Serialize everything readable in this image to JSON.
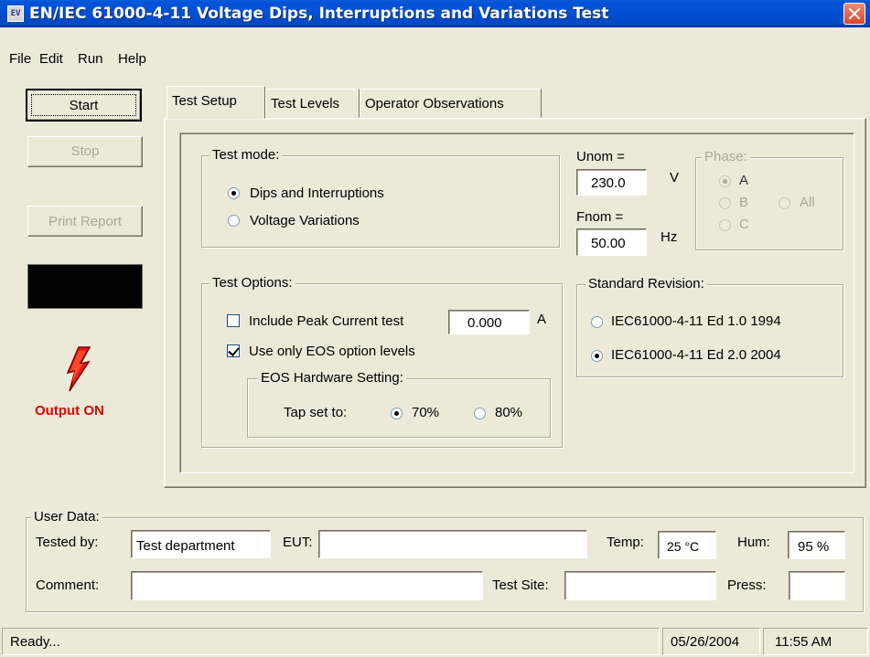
{
  "window": {
    "title": "EN/IEC 61000-4-11 Voltage Dips, Interruptions and Variations Test",
    "icon_text": "EV"
  },
  "menu": [
    {
      "label": "File"
    },
    {
      "label": "Edit"
    },
    {
      "label": "Run"
    },
    {
      "label": "Help"
    }
  ],
  "left_panel": {
    "start_label": "Start",
    "stop_label": "Stop",
    "print_label": "Print Report",
    "output_status": "Output ON",
    "output_color": "#e00000"
  },
  "tabs": [
    {
      "label": "Test Setup"
    },
    {
      "label": "Test Levels"
    },
    {
      "label": "Operator Observations"
    }
  ],
  "test_mode": {
    "title": "Test mode:",
    "options": [
      "Dips and Interruptions",
      "Voltage Variations"
    ],
    "selected": "Dips and Interruptions"
  },
  "nominal": {
    "unom_label": "Unom =",
    "unom_value": "230.0",
    "unom_unit": "V",
    "fnom_label": "Fnom =",
    "fnom_value": "50.00",
    "fnom_unit": "Hz"
  },
  "phase": {
    "title": "Phase:",
    "options": [
      "A",
      "B",
      "C",
      "All"
    ],
    "selected": "A"
  },
  "test_options": {
    "title": "Test Options:",
    "peak_label": "Include Peak Current test",
    "peak_checked": false,
    "peak_value": "0.000",
    "peak_unit": "A",
    "eos_label": "Use only EOS option levels",
    "eos_checked": true,
    "hw_title": "EOS Hardware Setting:",
    "tap_label": "Tap set to:",
    "tap_options": [
      "70%",
      "80%"
    ],
    "tap_selected": "70%"
  },
  "standard": {
    "title": "Standard Revision:",
    "options": [
      "IEC61000-4-11 Ed 1.0 1994",
      "IEC61000-4-11 Ed 2.0 2004"
    ],
    "selected": "IEC61000-4-11 Ed 2.0 2004"
  },
  "user_data": {
    "title": "User Data:",
    "tested_by_label": "Tested by:",
    "tested_by_value": "Test department",
    "eut_label": "EUT:",
    "eut_value": "",
    "temp_label": "Temp:",
    "temp_value": "25 °C",
    "hum_label": "Hum:",
    "hum_value": "95 %",
    "comment_label": "Comment:",
    "comment_value": "",
    "site_label": "Test Site:",
    "site_value": "",
    "press_label": "Press:",
    "press_value": ""
  },
  "status": {
    "message": "Ready...",
    "date": "05/26/2004",
    "time": "11:55 AM"
  }
}
